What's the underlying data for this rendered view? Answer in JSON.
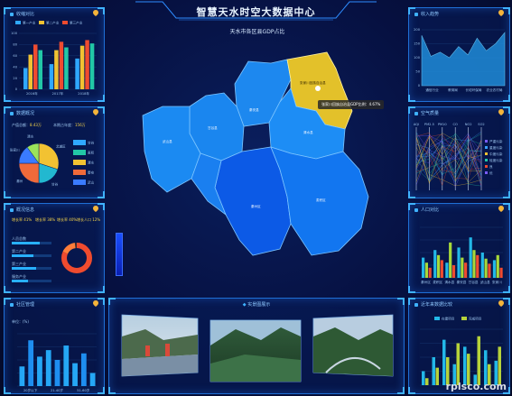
{
  "header": {
    "title": "智慧天水时空大数据中心"
  },
  "panels": {
    "left1": {
      "title": "收缩对比",
      "legend": [
        "第一产业",
        "第二产业",
        "第三产业"
      ],
      "years": [
        "2016年",
        "2017年",
        "2018年"
      ],
      "y_ticks": [
        "100",
        "80",
        "60",
        "40",
        "20",
        "0"
      ]
    },
    "left2": {
      "title": "数据概况",
      "total_label": "产值总额：",
      "total_value": "8.43万",
      "ratio_label": "本期占年度：",
      "ratio_value": "156万",
      "pie_labels": [
        "北道区",
        "甘谷",
        "秦州",
        "张家川",
        "清水"
      ],
      "pie_legend": [
        "甘谷",
        "麦积",
        "清水",
        "秦安",
        "武山"
      ]
    },
    "left3": {
      "title": "概况信息",
      "stats": [
        "增长率 41%",
        "增长率 38%",
        "增长率 40%",
        "增长人口 12%"
      ],
      "bars": [
        {
          "label": "人员总数"
        },
        {
          "label": "第二产业"
        },
        {
          "label": "第三产业"
        },
        {
          "label": "服务产业"
        }
      ],
      "donut_center": ""
    },
    "left4": {
      "title": "社区管理",
      "ylabel": "单位：(%)",
      "categories": [
        "20岁以下",
        "21-40岁",
        "51-60岁"
      ]
    },
    "bottom": {
      "title": "实景图展示"
    },
    "right1": {
      "title": "收入趋势",
      "x_labels": [
        "通信行业",
        "教育局",
        "长垣环保局",
        "农业农村局"
      ],
      "y_ticks": [
        "200",
        "150",
        "100",
        "50",
        "0"
      ]
    },
    "right2": {
      "title": "空气质量",
      "cols": [
        "AQI",
        "PM2.5",
        "PM10",
        "CO",
        "NO2",
        "SO2"
      ],
      "row_labels": [
        "严重污染",
        "重度污染",
        "中度污染",
        "轻度污染",
        "良",
        "优"
      ]
    },
    "right3": {
      "title": "人口对比",
      "x_labels": [
        "秦州区",
        "麦积区",
        "清水县",
        "秦安县",
        "甘谷县",
        "武山县",
        "张家川"
      ]
    },
    "right4": {
      "title": "近年来数据比较",
      "legend": [
        "在建项目",
        "完成项目"
      ]
    }
  },
  "map": {
    "title": "天水市各区县GDP占比",
    "regions": [
      "张家川回族自治县",
      "清水县",
      "秦安县",
      "秦州区",
      "麦积区",
      "甘谷县",
      "武山县",
      "天水区"
    ],
    "tooltip": "张家川回族自治县GDP比例：4.67%",
    "highlight": "张家川回族自治县"
  },
  "watermark": "rplsco.com",
  "chart_data": [
    {
      "type": "bar",
      "title": "收缩对比",
      "categories": [
        "2016年",
        "2017年",
        "2018年"
      ],
      "series": [
        {
          "name": "第一产业",
          "values": [
            38,
            45,
            55
          ]
        },
        {
          "name": "第二产业",
          "values": [
            62,
            70,
            78
          ]
        },
        {
          "name": "第三产业",
          "values": [
            80,
            85,
            88
          ]
        },
        {
          "values": [
            70,
            75,
            82
          ]
        }
      ],
      "ylim": [
        0,
        100
      ]
    },
    {
      "type": "pie",
      "title": "数据概况",
      "labels": [
        "北道区",
        "甘谷",
        "秦州",
        "张家川",
        "清水"
      ],
      "values": [
        30,
        20,
        25,
        15,
        10
      ]
    },
    {
      "type": "bar",
      "title": "社区管理",
      "categories": [
        "20岁以下",
        "21-40岁",
        "51-60岁"
      ],
      "values": [
        30,
        70,
        45,
        55,
        40,
        62,
        35,
        50,
        20
      ],
      "ylim": [
        0,
        80
      ]
    },
    {
      "type": "area",
      "title": "收入趋势",
      "categories": [
        "通信行业",
        "教育局",
        "长垣环保局",
        "农业农村局"
      ],
      "values": [
        180,
        105,
        120,
        100,
        140,
        110,
        170,
        125,
        150,
        190
      ],
      "ylim": [
        0,
        200
      ]
    },
    {
      "type": "bar",
      "title": "人口对比",
      "categories": [
        "秦州区",
        "麦积区",
        "清水县",
        "秦安县",
        "甘谷县",
        "武山县",
        "张家川"
      ],
      "series": [
        {
          "values": [
            40,
            55,
            30,
            60,
            80,
            50,
            35
          ]
        },
        {
          "values": [
            30,
            45,
            70,
            40,
            55,
            38,
            45
          ]
        },
        {
          "values": [
            20,
            35,
            25,
            30,
            45,
            28,
            20
          ]
        }
      ],
      "ylim": [
        0,
        100
      ]
    },
    {
      "type": "bar",
      "title": "近年来数据比较",
      "series": [
        {
          "name": "在建项目",
          "values": [
            20,
            40,
            65,
            30,
            55,
            15,
            50,
            35
          ]
        },
        {
          "name": "完成项目",
          "values": [
            10,
            25,
            40,
            60,
            45,
            70,
            30,
            55
          ]
        }
      ],
      "ylim": [
        0,
        80
      ]
    }
  ],
  "colors": {
    "accent": "#3fb2ff",
    "panel_border": "#1f6fd6",
    "map_blue": "#1a7bff",
    "map_highlight": "#e3c12a"
  }
}
